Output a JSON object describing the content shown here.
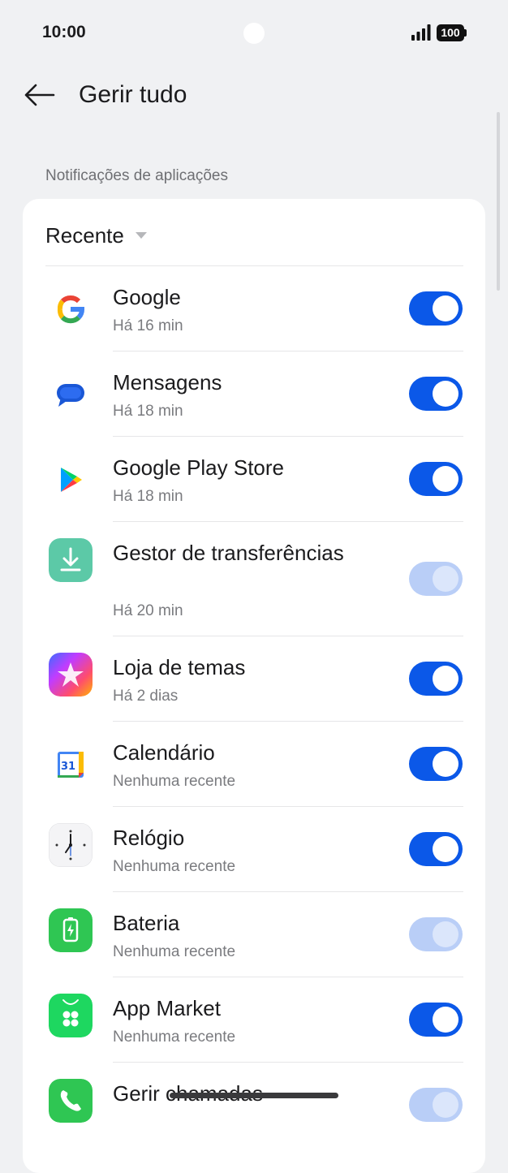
{
  "status_bar": {
    "time": "10:00",
    "battery": "100"
  },
  "header": {
    "title": "Gerir tudo"
  },
  "section": {
    "label": "Notificações de aplicações"
  },
  "sort": {
    "label": "Recente"
  },
  "apps": [
    {
      "name": "Google",
      "subtitle": "Há 16 min",
      "enabled": true
    },
    {
      "name": "Mensagens",
      "subtitle": "Há 18 min",
      "enabled": true
    },
    {
      "name": "Google Play Store",
      "subtitle": "Há 18 min",
      "enabled": true
    },
    {
      "name": "Gestor de transferências",
      "subtitle": "Há 20 min",
      "enabled": true,
      "toggle_disabled": true
    },
    {
      "name": "Loja de temas",
      "subtitle": "Há 2 dias",
      "enabled": true
    },
    {
      "name": "Calendário",
      "subtitle": "Nenhuma recente",
      "enabled": true,
      "calendar_day": "31"
    },
    {
      "name": "Relógio",
      "subtitle": "Nenhuma recente",
      "enabled": true
    },
    {
      "name": "Bateria",
      "subtitle": "Nenhuma recente",
      "enabled": true,
      "toggle_disabled": true
    },
    {
      "name": "App Market",
      "subtitle": "Nenhuma recente",
      "enabled": true
    },
    {
      "name": "Gerir chamadas",
      "subtitle": "",
      "enabled": true,
      "toggle_disabled": true
    }
  ],
  "colors": {
    "toggle_on": "#0b58e8",
    "toggle_disabled": "#b9cef7",
    "background": "#f0f1f3"
  }
}
